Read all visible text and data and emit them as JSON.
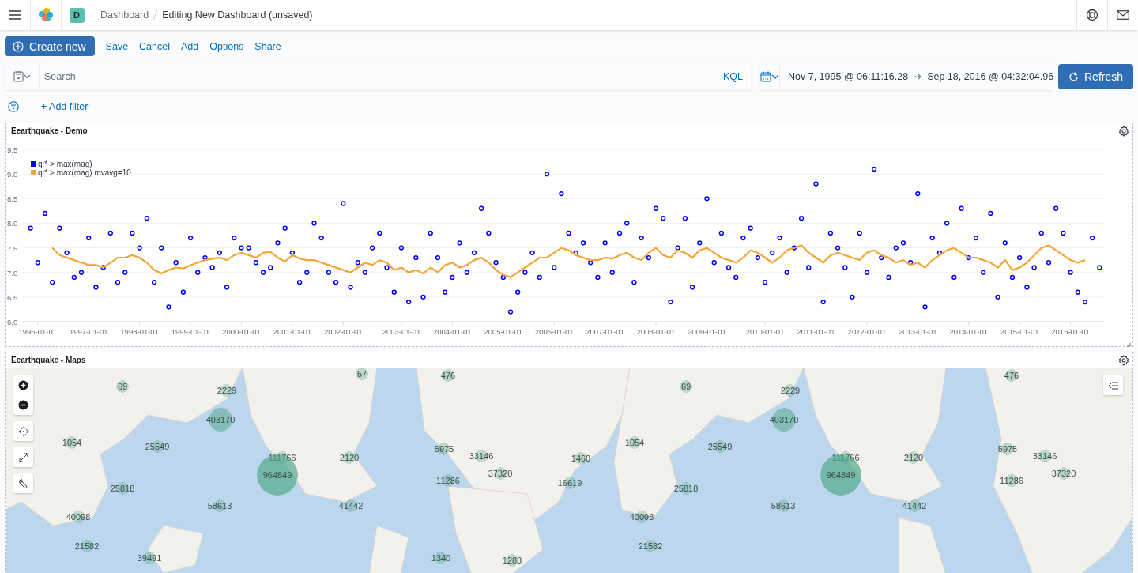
{
  "header": {
    "space_badge": "D",
    "breadcrumbs": [
      {
        "label": "Dashboard",
        "current": false
      },
      {
        "label": "Editing New Dashboard (unsaved)",
        "current": true
      }
    ]
  },
  "top_nav": {
    "primary_button": "Create new",
    "links": [
      "Save",
      "Cancel",
      "Add",
      "Options",
      "Share"
    ]
  },
  "query_bar": {
    "search": {
      "placeholder": "Search"
    },
    "language": "KQL",
    "time_start": "Nov 7, 1995 @ 06:11:16.28",
    "time_end": "Sep 18, 2016 @ 04:32:04.96",
    "refresh_button": "Refresh"
  },
  "filter_bar": {
    "add_filter": "+ Add filter"
  },
  "panels": [
    {
      "kind": "chart",
      "title": "Eearthquake - Demo",
      "chart_data": {
        "type": "line",
        "grid": true,
        "legend": "upper left",
        "ylim": [
          6.0,
          9.5
        ],
        "categories": [
          null,
          "1996-01-01",
          null,
          null,
          null,
          null,
          null,
          null,
          "1997-01-01",
          null,
          null,
          null,
          null,
          null,
          null,
          "1998-01-01",
          null,
          null,
          null,
          null,
          null,
          null,
          "1999-01-01",
          null,
          null,
          null,
          null,
          null,
          null,
          "2000-01-01",
          null,
          null,
          null,
          null,
          null,
          null,
          "2001-01-01",
          null,
          null,
          null,
          null,
          null,
          null,
          "2002-01-01",
          null,
          null,
          null,
          null,
          null,
          null,
          null,
          "2003-01-01",
          null,
          null,
          null,
          null,
          null,
          null,
          "2004-01-01",
          null,
          null,
          null,
          null,
          null,
          null,
          "2005-01-01",
          null,
          null,
          null,
          null,
          null,
          null,
          "2006-01-01",
          null,
          null,
          null,
          null,
          null,
          null,
          "2007-01-01",
          null,
          null,
          null,
          null,
          null,
          null,
          "2008-01-01",
          null,
          null,
          null,
          null,
          null,
          null,
          "2009-01-01",
          null,
          null,
          null,
          null,
          null,
          null,
          null,
          "2010-01-01",
          null,
          null,
          null,
          null,
          null,
          null,
          "2011-01-01",
          null,
          null,
          null,
          null,
          null,
          null,
          "2012-01-01",
          null,
          null,
          null,
          null,
          null,
          null,
          "2013-01-01",
          null,
          null,
          null,
          null,
          null,
          null,
          "2014-01-01",
          null,
          null,
          null,
          null,
          null,
          null,
          "2015-01-01",
          null,
          null,
          null,
          null,
          null,
          null,
          "2016-01-01",
          null,
          null,
          null,
          null
        ],
        "yticks": [
          {
            "value": 6.0,
            "label": "6.0"
          },
          {
            "value": 6.5,
            "label": "6.5"
          },
          {
            "value": 7.0,
            "label": "7.0"
          },
          {
            "value": 7.5,
            "label": "7.5"
          },
          {
            "value": 8.0,
            "label": "8.0"
          },
          {
            "value": 8.5,
            "label": "8.5"
          },
          {
            "value": 9.0,
            "label": "9.0"
          },
          {
            "value": 9.5,
            "label": "9.5"
          }
        ],
        "series": [
          {
            "name": "q:* > max(mag)",
            "type": "scatter",
            "color": "#0000ff",
            "values": [
              7.9,
              7.2,
              8.2,
              6.8,
              7.9,
              7.4,
              6.9,
              7.0,
              7.7,
              6.7,
              7.1,
              7.8,
              6.8,
              7.0,
              7.8,
              7.5,
              8.1,
              6.8,
              7.5,
              6.3,
              7.2,
              6.6,
              7.7,
              7.0,
              7.3,
              7.1,
              7.4,
              6.7,
              7.7,
              7.5,
              7.5,
              7.2,
              7.0,
              7.1,
              7.6,
              7.9,
              7.4,
              6.8,
              7.0,
              8.0,
              7.7,
              7.0,
              6.8,
              8.4,
              6.7,
              7.2,
              7.0,
              7.5,
              7.8,
              7.1,
              6.6,
              7.5,
              6.4,
              7.3,
              6.5,
              7.8,
              7.3,
              6.6,
              6.9,
              7.6,
              7.0,
              7.4,
              8.3,
              7.8,
              7.2,
              6.9,
              6.2,
              6.6,
              7.0,
              7.4,
              6.9,
              9.0,
              7.1,
              8.6,
              7.8,
              7.4,
              7.6,
              7.2,
              6.9,
              7.6,
              7.0,
              7.8,
              8.0,
              6.8,
              7.7,
              7.3,
              8.3,
              8.1,
              6.4,
              7.5,
              8.1,
              6.7,
              7.6,
              8.5,
              7.2,
              7.8,
              7.1,
              6.9,
              7.7,
              7.9,
              7.3,
              6.8,
              7.4,
              7.7,
              7.0,
              7.5,
              8.1,
              7.1,
              8.8,
              6.4,
              7.8,
              7.5,
              7.1,
              6.5,
              7.8,
              7.0,
              9.1,
              7.3,
              6.9,
              7.5,
              7.6,
              7.2,
              8.6,
              6.3,
              7.7,
              7.4,
              8.0,
              6.9,
              8.3,
              7.3,
              7.7,
              7.0,
              8.2,
              6.5,
              7.6,
              6.9,
              7.3,
              6.7,
              7.1,
              7.8,
              7.2,
              8.3,
              7.8,
              7.0,
              6.6,
              6.4,
              7.7,
              7.1
            ]
          },
          {
            "name": "q:* > max(mag) mvavg=10",
            "type": "line",
            "color": "#f5a535",
            "values": [
              null,
              null,
              null,
              7.5,
              7.35,
              7.3,
              7.25,
              7.2,
              7.15,
              7.15,
              7.1,
              7.2,
              7.3,
              7.3,
              7.35,
              7.3,
              7.2,
              7.05,
              6.98,
              7.05,
              7.1,
              7.08,
              7.15,
              7.2,
              7.25,
              7.28,
              7.3,
              7.25,
              7.35,
              7.4,
              7.35,
              7.3,
              7.4,
              7.42,
              7.3,
              7.22,
              7.35,
              7.28,
              7.25,
              7.25,
              7.2,
              7.15,
              7.1,
              7.05,
              7.0,
              7.1,
              7.2,
              7.15,
              7.25,
              7.2,
              7.05,
              7.1,
              7.0,
              7.05,
              6.98,
              7.1,
              7.0,
              7.15,
              7.2,
              7.1,
              7.15,
              7.25,
              7.3,
              7.2,
              7.05,
              6.95,
              6.9,
              7.0,
              7.1,
              7.2,
              7.3,
              7.3,
              7.4,
              7.5,
              7.45,
              7.35,
              7.3,
              7.25,
              7.25,
              7.3,
              7.28,
              7.35,
              7.4,
              7.3,
              7.25,
              7.4,
              7.5,
              7.35,
              7.3,
              7.45,
              7.4,
              7.3,
              7.45,
              7.5,
              7.4,
              7.3,
              7.25,
              7.2,
              7.3,
              7.45,
              7.4,
              7.3,
              7.2,
              7.3,
              7.45,
              7.5,
              7.55,
              7.4,
              7.3,
              7.2,
              7.35,
              7.4,
              7.35,
              7.3,
              7.25,
              7.4,
              7.45,
              7.35,
              7.3,
              7.2,
              7.25,
              7.15,
              7.2,
              7.1,
              7.25,
              7.35,
              7.45,
              7.5,
              7.4,
              7.3,
              7.3,
              7.25,
              7.2,
              7.1,
              7.25,
              7.05,
              7.1,
              7.2,
              7.35,
              7.5,
              7.55,
              7.45,
              7.35,
              7.25,
              7.2,
              7.25,
              null,
              null
            ]
          }
        ]
      }
    },
    {
      "kind": "map",
      "title": "Eearthquake - Maps",
      "markers": [
        {
          "label": "69"
        },
        {
          "label": "57"
        },
        {
          "label": "476"
        },
        {
          "label": "2229"
        },
        {
          "label": "403170"
        },
        {
          "label": "1054"
        },
        {
          "label": "25549"
        },
        {
          "label": "111766"
        },
        {
          "label": "964849"
        },
        {
          "label": "2120"
        },
        {
          "label": "5975"
        },
        {
          "label": "33146"
        },
        {
          "label": "1460"
        },
        {
          "label": "1054"
        },
        {
          "label": "25549"
        },
        {
          "label": "37320"
        },
        {
          "label": "11286"
        },
        {
          "label": "16619"
        },
        {
          "label": "25818"
        },
        {
          "label": "58613"
        },
        {
          "label": "41442"
        },
        {
          "label": "40098"
        },
        {
          "label": "21582"
        },
        {
          "label": "39491"
        },
        {
          "label": "1340"
        },
        {
          "label": "1283"
        },
        {
          "label": "69"
        },
        {
          "label": "2229"
        },
        {
          "label": "403170"
        },
        {
          "label": "111766"
        },
        {
          "label": "964849"
        },
        {
          "label": "2120"
        },
        {
          "label": "5975"
        },
        {
          "label": "33146"
        },
        {
          "label": "476"
        },
        {
          "label": "37320"
        },
        {
          "label": "11286"
        },
        {
          "label": "25818"
        },
        {
          "label": "58613"
        },
        {
          "label": "41442"
        },
        {
          "label": "40098"
        },
        {
          "label": "21582"
        }
      ]
    }
  ]
}
